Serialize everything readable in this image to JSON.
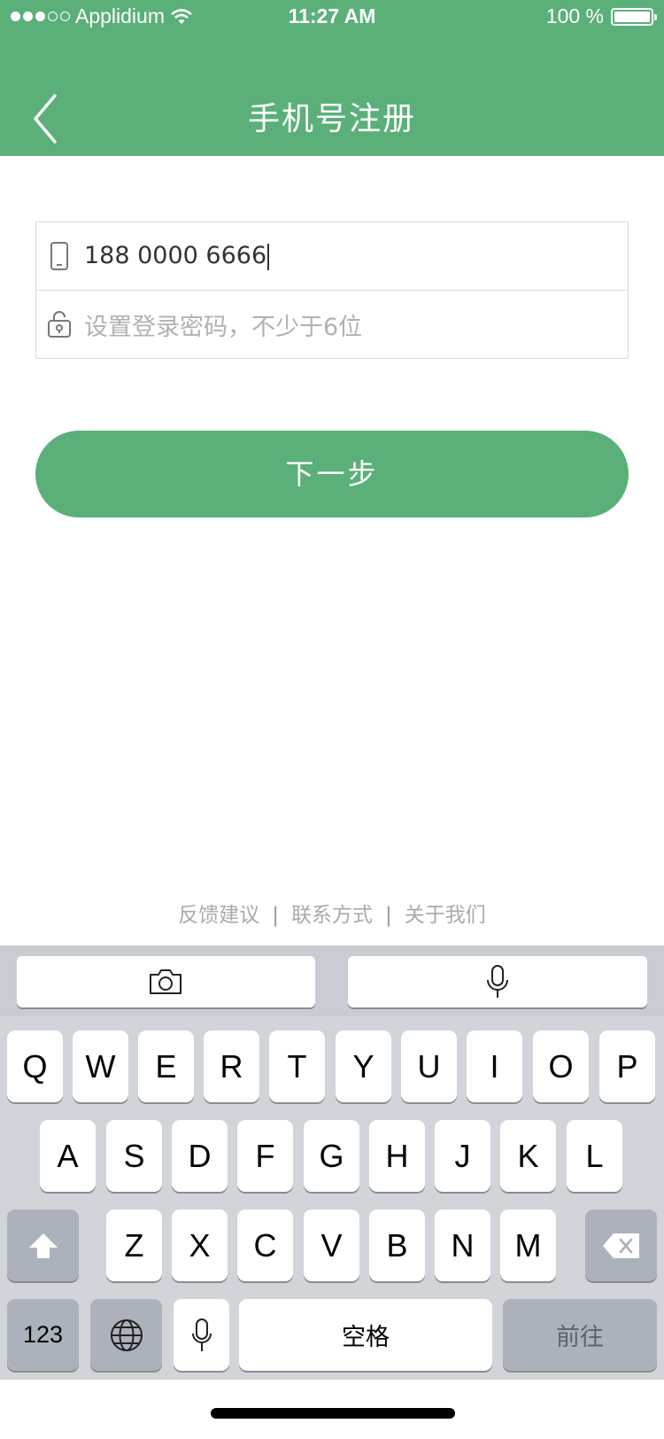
{
  "status_bar": {
    "carrier": "Applidium",
    "time": "11:27 AM",
    "battery": "100 %"
  },
  "header": {
    "title": "手机号注册"
  },
  "form": {
    "phone_value": "188 0000 6666",
    "password_placeholder": "设置登录密码，不少于6位"
  },
  "primary_button": {
    "label": "下一步"
  },
  "footer_links": [
    "反馈建议",
    "联系方式",
    "关于我们"
  ],
  "keyboard": {
    "row1": [
      "Q",
      "W",
      "E",
      "R",
      "T",
      "Y",
      "U",
      "I",
      "O",
      "P"
    ],
    "row2": [
      "A",
      "S",
      "D",
      "F",
      "G",
      "H",
      "J",
      "K",
      "L"
    ],
    "row3": [
      "Z",
      "X",
      "C",
      "V",
      "B",
      "N",
      "M"
    ],
    "numbers_key": "123",
    "space_key": "空格",
    "go_key": "前往"
  },
  "colors": {
    "accent": "#5bb07a",
    "keyboard_bg": "#d1d4d9"
  }
}
